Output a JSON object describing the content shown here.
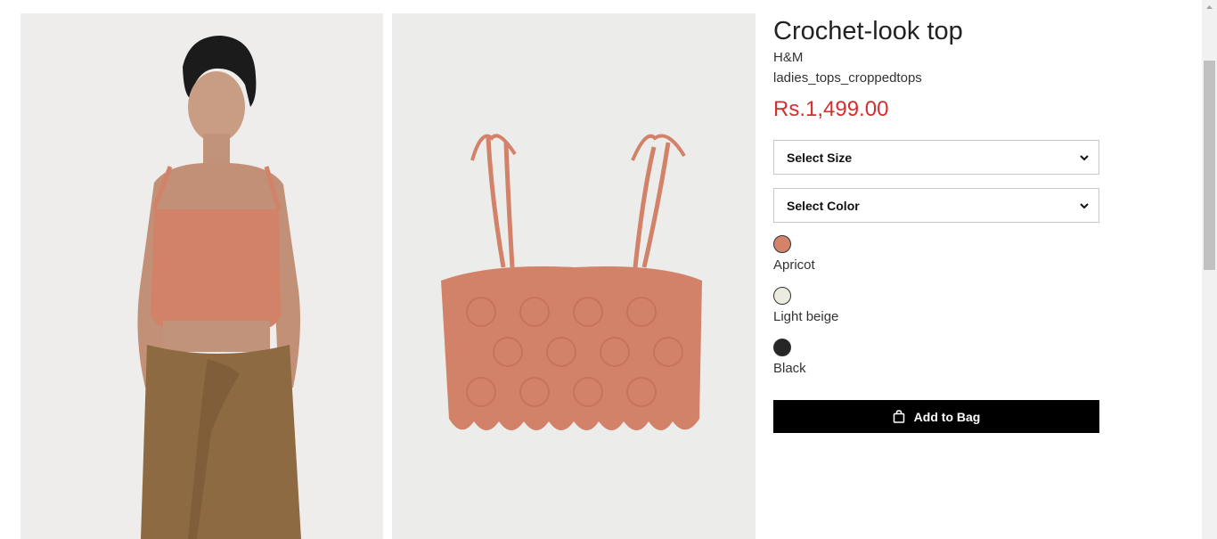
{
  "product": {
    "title": "Crochet-look top",
    "brand": "H&M",
    "category": "ladies_tops_croppedtops",
    "price": "Rs.1,499.00"
  },
  "selects": {
    "size_label": "Select Size",
    "color_label": "Select Color"
  },
  "colors": [
    {
      "name": "Apricot",
      "hex": "#d4836b"
    },
    {
      "name": "Light beige",
      "hex": "#ecebdf"
    },
    {
      "name": "Black",
      "hex": "#262626"
    }
  ],
  "actions": {
    "add_to_bag": "Add to Bag"
  },
  "icons": {
    "bag": "shopping-bag-icon",
    "chevron": "chevron-down-icon"
  },
  "theme": {
    "price_color": "#d03030",
    "button_bg": "#000000"
  }
}
